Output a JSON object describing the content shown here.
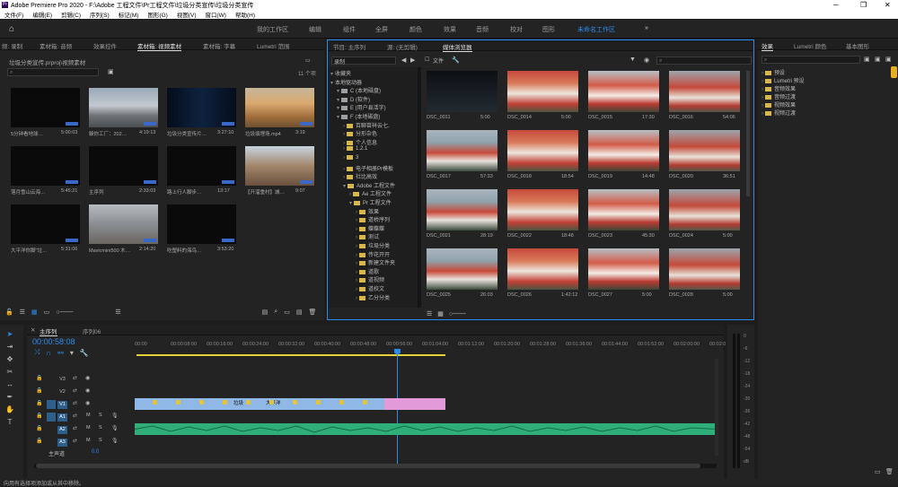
{
  "titlebar": {
    "text": "Adobe Premiere Pro 2020 - F:\\Adobe 工程文件\\Pr工程文件\\垃圾分类宣传\\垃圾分类宣传",
    "app_icon": "Pr"
  },
  "menu": [
    "文件(F)",
    "编辑(E)",
    "剪辑(C)",
    "序列(S)",
    "标记(M)",
    "图形(G)",
    "视图(V)",
    "窗口(W)",
    "帮助(H)"
  ],
  "workspaces": [
    {
      "label": "我的工作区",
      "active": false
    },
    {
      "label": "编辑",
      "active": false
    },
    {
      "label": "组件",
      "active": false
    },
    {
      "label": "全屏",
      "active": false
    },
    {
      "label": "颜色",
      "active": false
    },
    {
      "label": "效果",
      "active": false
    },
    {
      "label": "音频",
      "active": false
    },
    {
      "label": "校对",
      "active": false
    },
    {
      "label": "图形",
      "active": false
    },
    {
      "label": "未命名工作区",
      "active": true
    }
  ],
  "project_panel": {
    "tabs": [
      "频: 录制",
      "素材箱: 音频",
      "效果控件",
      "素材箱: 视频素材",
      "素材箱: 字幕",
      "Lumetri 范围"
    ],
    "active_tab": "素材箱: 视频素材",
    "path": "垃圾分类宣传.prproj\\视频素材",
    "count": "11 个项",
    "items": [
      {
        "name": "5分钟看地球…",
        "dur": "5:00:03",
        "style": "dark"
      },
      {
        "name": "躲你工厂：202…",
        "dur": "4:19:13",
        "style": "city"
      },
      {
        "name": "垃圾分类宣传片…",
        "dur": "3:27:10",
        "style": "title"
      },
      {
        "name": "垃圾填埋场.mp4",
        "dur": "3:19",
        "style": "digger"
      },
      {
        "name": "落月雪山云海…",
        "dur": "5:45:21",
        "style": "dark"
      },
      {
        "name": "主序列",
        "dur": "2:33:03",
        "style": "dark"
      },
      {
        "name": "路上行人脚步…",
        "dur": "13:17",
        "style": "dark"
      },
      {
        "name": "【开溜重村】城…",
        "dur": "9:07",
        "style": "street"
      },
      {
        "name": "大平洋你脚\"垃…",
        "dur": "5:31:06",
        "style": "dark"
      },
      {
        "name": "Mavicmini500 木…",
        "dur": "2:14:20",
        "style": "construct"
      },
      {
        "name": "吃塑料的海鸟…",
        "dur": "3:53:20",
        "style": "dark"
      }
    ]
  },
  "media_browser": {
    "tabs": [
      "节目: 主序列",
      "源: (无剪辑)",
      "媒体浏览器"
    ],
    "active_tab": "媒体浏览器",
    "dropdown": "录制",
    "search_placeholder": "",
    "file_label": "文件",
    "tree": [
      {
        "label": "收藏夹",
        "indent": 0
      },
      {
        "label": "本地驱动器",
        "indent": 0
      },
      {
        "label": "C (本地磁盘)",
        "indent": 1
      },
      {
        "label": "D (软件)",
        "indent": 1
      },
      {
        "label": "E (用户县活字)",
        "indent": 1
      },
      {
        "label": "F (本地磁盘)",
        "indent": 1
      },
      {
        "label": "百聊苗祥云七.",
        "indent": 2
      },
      {
        "label": "分形杂色",
        "indent": 2
      },
      {
        "label": "个人信息",
        "indent": 2
      },
      {
        "label": "1.2.1",
        "indent": 2
      },
      {
        "label": "3",
        "indent": 2
      },
      {
        "label": "电子相册Pr模板",
        "indent": 2
      },
      {
        "label": "社比高效",
        "indent": 2
      },
      {
        "label": "Adobe 工程文件",
        "indent": 2
      },
      {
        "label": "Ae 工程文件",
        "indent": 3
      },
      {
        "label": "Pr 工程文件",
        "indent": 3
      },
      {
        "label": "效果",
        "indent": 4
      },
      {
        "label": "道桥序列",
        "indent": 4
      },
      {
        "label": "蝶蝶蝶",
        "indent": 4
      },
      {
        "label": "测试",
        "indent": 4
      },
      {
        "label": "垃圾分类",
        "indent": 4
      },
      {
        "label": "传花开开",
        "indent": 4
      },
      {
        "label": "新建文件夹",
        "indent": 4
      },
      {
        "label": "道歌",
        "indent": 4
      },
      {
        "label": "道视频",
        "indent": 4
      },
      {
        "label": "道校文",
        "indent": 4
      },
      {
        "label": "乙分分类",
        "indent": 4
      }
    ],
    "files": [
      {
        "name": "DSC_0011",
        "dur": "5:00",
        "style": "night"
      },
      {
        "name": "DSC_0014",
        "dur": "5:00",
        "style": "photo"
      },
      {
        "name": "DSC_0015",
        "dur": "17:30",
        "style": "photo"
      },
      {
        "name": "DSC_0016",
        "dur": "54:06",
        "style": "photo"
      },
      {
        "name": "DSC_0017",
        "dur": "57:33",
        "style": "photo"
      },
      {
        "name": "DSC_0018",
        "dur": "18:54",
        "style": "photo"
      },
      {
        "name": "DSC_0019",
        "dur": "14:48",
        "style": "photo"
      },
      {
        "name": "DSC_0020",
        "dur": "36:51",
        "style": "photo"
      },
      {
        "name": "DSC_0021",
        "dur": "28:19",
        "style": "photo"
      },
      {
        "name": "DSC_0022",
        "dur": "18:48",
        "style": "photo"
      },
      {
        "name": "DSC_0023",
        "dur": "45:30",
        "style": "photo"
      },
      {
        "name": "DSC_0024",
        "dur": "5:00",
        "style": "photo"
      },
      {
        "name": "DSC_0025",
        "dur": "26:03",
        "style": "photo"
      },
      {
        "name": "DSC_0026",
        "dur": "1:42:12",
        "style": "photo"
      },
      {
        "name": "DSC_0027",
        "dur": "5:00",
        "style": "photo"
      },
      {
        "name": "DSC_0028",
        "dur": "5:00",
        "style": "photo"
      }
    ]
  },
  "effects_panel": {
    "tabs": [
      "效果",
      "Lumetri 颜色",
      "基本图形"
    ],
    "active_tab": "效果",
    "items": [
      "预设",
      "Lumetri 预设",
      "音频效果",
      "音频过渡",
      "视频效果",
      "视频过渡"
    ]
  },
  "timeline": {
    "tabs": [
      "主序列",
      "序列06"
    ],
    "active_tab": "主序列",
    "timecode": "00:00:58:08",
    "ruler": [
      "00:00",
      "00:00:08:00",
      "00:00:16:00",
      "00:00:24:00",
      "00:00:32:00",
      "00:00:40:00",
      "00:00:48:00",
      "00:00:56:00",
      "00:01:04:00",
      "00:01:12:00",
      "00:01:20:00",
      "00:01:28:00",
      "00:01:36:00",
      "00:01:44:00",
      "00:01:52:00",
      "00:02:00:00",
      "00:02:0"
    ],
    "video_tracks": [
      "V3",
      "V2",
      "V1"
    ],
    "audio_tracks": [
      "A1",
      "A2",
      "A3"
    ],
    "master": "主声道",
    "master_value": "0.0",
    "clip_labels": [
      "垃圾",
      "大平洋",
      "大平洋你脚",
      "垃圾",
      "学塞"
    ],
    "meter_scale": [
      "0",
      "-6",
      "-12",
      "-18",
      "-24",
      "-30",
      "-36",
      "-42",
      "-48",
      "-54",
      "dB"
    ]
  },
  "statusbar": "向用有选择项添加或从其中移除。",
  "colors": {
    "accent": "#2d8ceb",
    "clip_blue": "#8fb8e6",
    "clip_pink": "#e39ad8",
    "audio_green": "#2fae7a"
  }
}
